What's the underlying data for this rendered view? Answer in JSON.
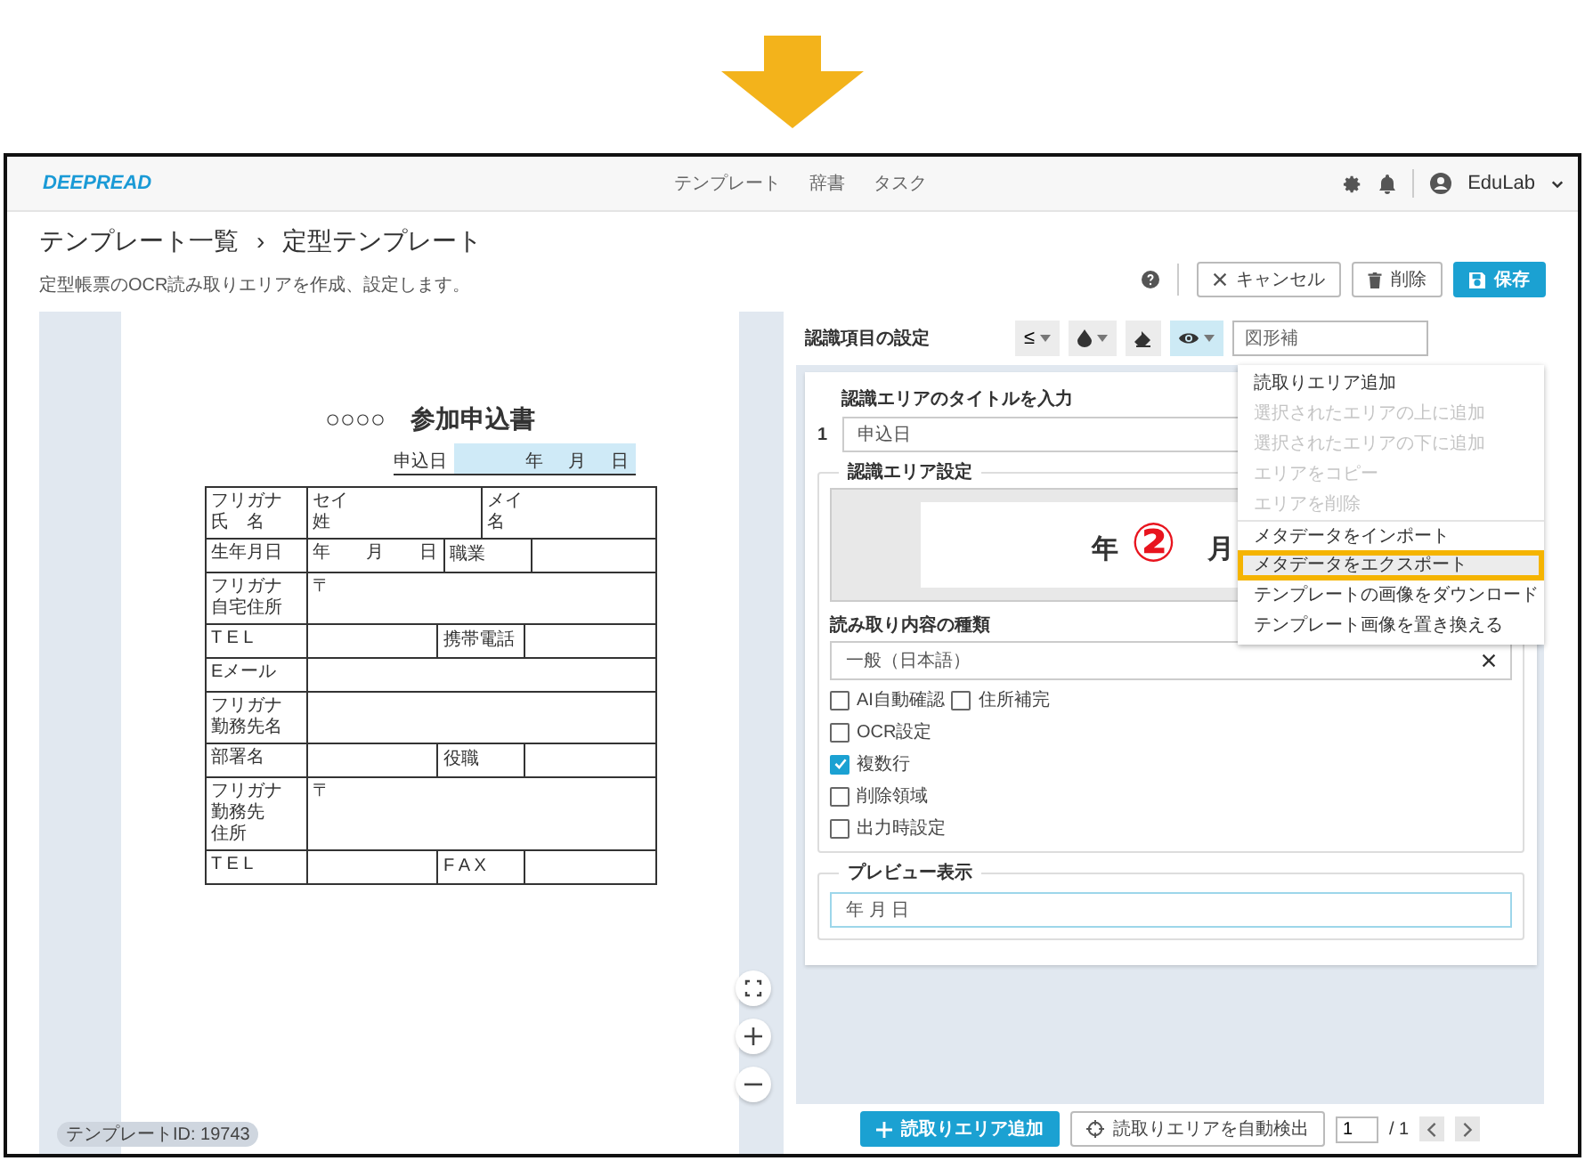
{
  "annotation_arrow": {
    "kind": "down"
  },
  "navbar": {
    "logo": "DEEPREAD",
    "links": [
      "テンプレート",
      "辞書",
      "タスク"
    ],
    "user": "EduLab"
  },
  "page_header": {
    "breadcrumb": [
      "テンプレート一覧",
      "›",
      "定型テンプレート"
    ],
    "subtitle": "定型帳票のOCR読み取りエリアを作成、設定します。",
    "buttons": [
      {
        "label": "キャンセル",
        "kind": "outline"
      },
      {
        "label": "削除",
        "kind": "outline"
      },
      {
        "label": "保存",
        "kind": "primary"
      }
    ]
  },
  "document": {
    "title": "○○○○　参加申込書",
    "date_label": "申込日",
    "date_parts": [
      "年",
      "月",
      "日"
    ],
    "rows": [
      {
        "label": [
          "フリガナ",
          "氏　名"
        ],
        "cells": [
          {
            "kind": "field",
            "lines": [
              "セイ",
              "姓"
            ]
          },
          {
            "kind": "field",
            "lines": [
              "メイ",
              "名"
            ]
          }
        ]
      },
      {
        "label": [
          "生年月日"
        ],
        "cells": [
          {
            "kind": "field",
            "lines": [
              "年　　月　　日"
            ]
          },
          {
            "kind": "label",
            "lines": [
              "職業"
            ]
          },
          {
            "kind": "field"
          }
        ]
      },
      {
        "label": [
          "フリガナ",
          "自宅住所"
        ],
        "cells": [
          {
            "kind": "field",
            "lines": [
              "〒"
            ]
          }
        ]
      },
      {
        "label": [
          "T E L"
        ],
        "cells": [
          {
            "kind": "field"
          },
          {
            "kind": "label",
            "lines": [
              "携帯電話"
            ]
          },
          {
            "kind": "field"
          }
        ]
      },
      {
        "label": [
          "Eメール"
        ],
        "cells": [
          {
            "kind": "field"
          }
        ]
      },
      {
        "label": [
          "フリガナ",
          "勤務先名"
        ],
        "cells": [
          {
            "kind": "field"
          }
        ]
      },
      {
        "label": [
          "部署名"
        ],
        "cells": [
          {
            "kind": "field"
          },
          {
            "kind": "label",
            "lines": [
              "役職"
            ]
          },
          {
            "kind": "field"
          }
        ]
      },
      {
        "label": [
          "フリガナ",
          "勤務先",
          "住所"
        ],
        "cells": [
          {
            "kind": "field",
            "lines": [
              "〒"
            ]
          }
        ]
      },
      {
        "label": [
          "T E L"
        ],
        "cells": [
          {
            "kind": "field"
          },
          {
            "kind": "label",
            "lines": [
              "F A X"
            ]
          },
          {
            "kind": "field"
          }
        ]
      }
    ],
    "template_id": "テンプレートID: 19743"
  },
  "settings": {
    "title": "認識項目の設定",
    "tools": [
      {
        "glyph": "≤",
        "has_caret": true,
        "selected": false
      },
      {
        "has_caret": true,
        "selected": false
      },
      {
        "has_caret": false,
        "selected": false
      },
      {
        "has_caret": true,
        "selected": true
      }
    ],
    "shape_select": "図形補",
    "area": {
      "index": "1",
      "title_label": "認識エリアのタイトルを入力",
      "title_value": "申込日",
      "area_legend": "認識エリア設定",
      "crop_text": [
        "年",
        "月"
      ],
      "annotation": "②",
      "type_label": "読み取り内容の種類",
      "type_value": "一般（日本語）",
      "checkbox_rows": [
        [
          {
            "label": "AI自動確認",
            "checked": false
          },
          {
            "label": "住所補完",
            "checked": false
          }
        ],
        [
          {
            "label": "OCR設定",
            "checked": false
          }
        ],
        [
          {
            "label": "複数行",
            "checked": true
          }
        ],
        [
          {
            "label": "削除領域",
            "checked": false
          }
        ],
        [
          {
            "label": "出力時設定",
            "checked": false
          }
        ]
      ],
      "preview_legend": "プレビュー表示",
      "preview_value": "年 月 日"
    },
    "menu": [
      {
        "label": "読取りエリア追加",
        "disabled": false,
        "divider_above": false,
        "highlighted": false
      },
      {
        "label": "選択されたエリアの上に追加",
        "disabled": true,
        "divider_above": false,
        "highlighted": false
      },
      {
        "label": "選択されたエリアの下に追加",
        "disabled": true,
        "divider_above": false,
        "highlighted": false
      },
      {
        "label": "エリアをコピー",
        "disabled": true,
        "divider_above": false,
        "highlighted": false
      },
      {
        "label": "エリアを削除",
        "disabled": true,
        "divider_above": false,
        "highlighted": false
      },
      {
        "label": "メタデータをインポート",
        "disabled": false,
        "divider_above": true,
        "highlighted": false
      },
      {
        "label": "メタデータをエクスポート",
        "disabled": false,
        "divider_above": false,
        "highlighted": true
      },
      {
        "label": "テンプレートの画像をダウンロード",
        "disabled": false,
        "divider_above": false,
        "highlighted": false
      },
      {
        "label": "テンプレート画像を置き換える",
        "disabled": false,
        "divider_above": false,
        "highlighted": false
      }
    ],
    "footer": {
      "add_button": "読取りエリア追加",
      "detect_button": "読取りエリアを自動検出",
      "page_value": "1",
      "page_total": "/ 1"
    }
  }
}
